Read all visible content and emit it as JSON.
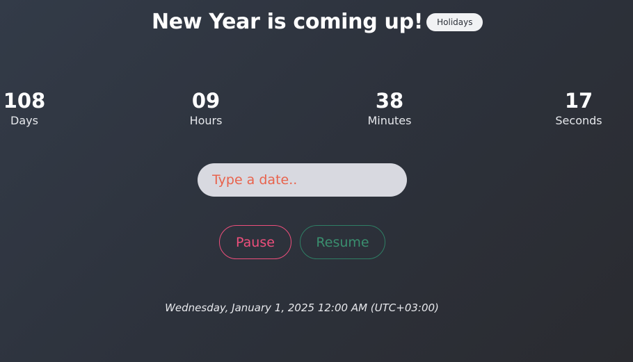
{
  "header": {
    "title": "New Year is coming up!",
    "badge_label": "Holidays"
  },
  "countdown": {
    "days": {
      "value": "108",
      "label": "Days"
    },
    "hours": {
      "value": "09",
      "label": "Hours"
    },
    "minutes": {
      "value": "38",
      "label": "Minutes"
    },
    "seconds": {
      "value": "17",
      "label": "Seconds"
    }
  },
  "date_input": {
    "placeholder": "Type a date..",
    "value": ""
  },
  "controls": {
    "pause_label": "Pause",
    "resume_label": "Resume"
  },
  "target_date": "Wednesday, January 1, 2025 12:00 AM (UTC+03:00)",
  "colors": {
    "pause": "#ee4f7c",
    "resume": "#3a8f6f",
    "placeholder": "#e8634d",
    "badge_bg": "#f1f2f4"
  }
}
